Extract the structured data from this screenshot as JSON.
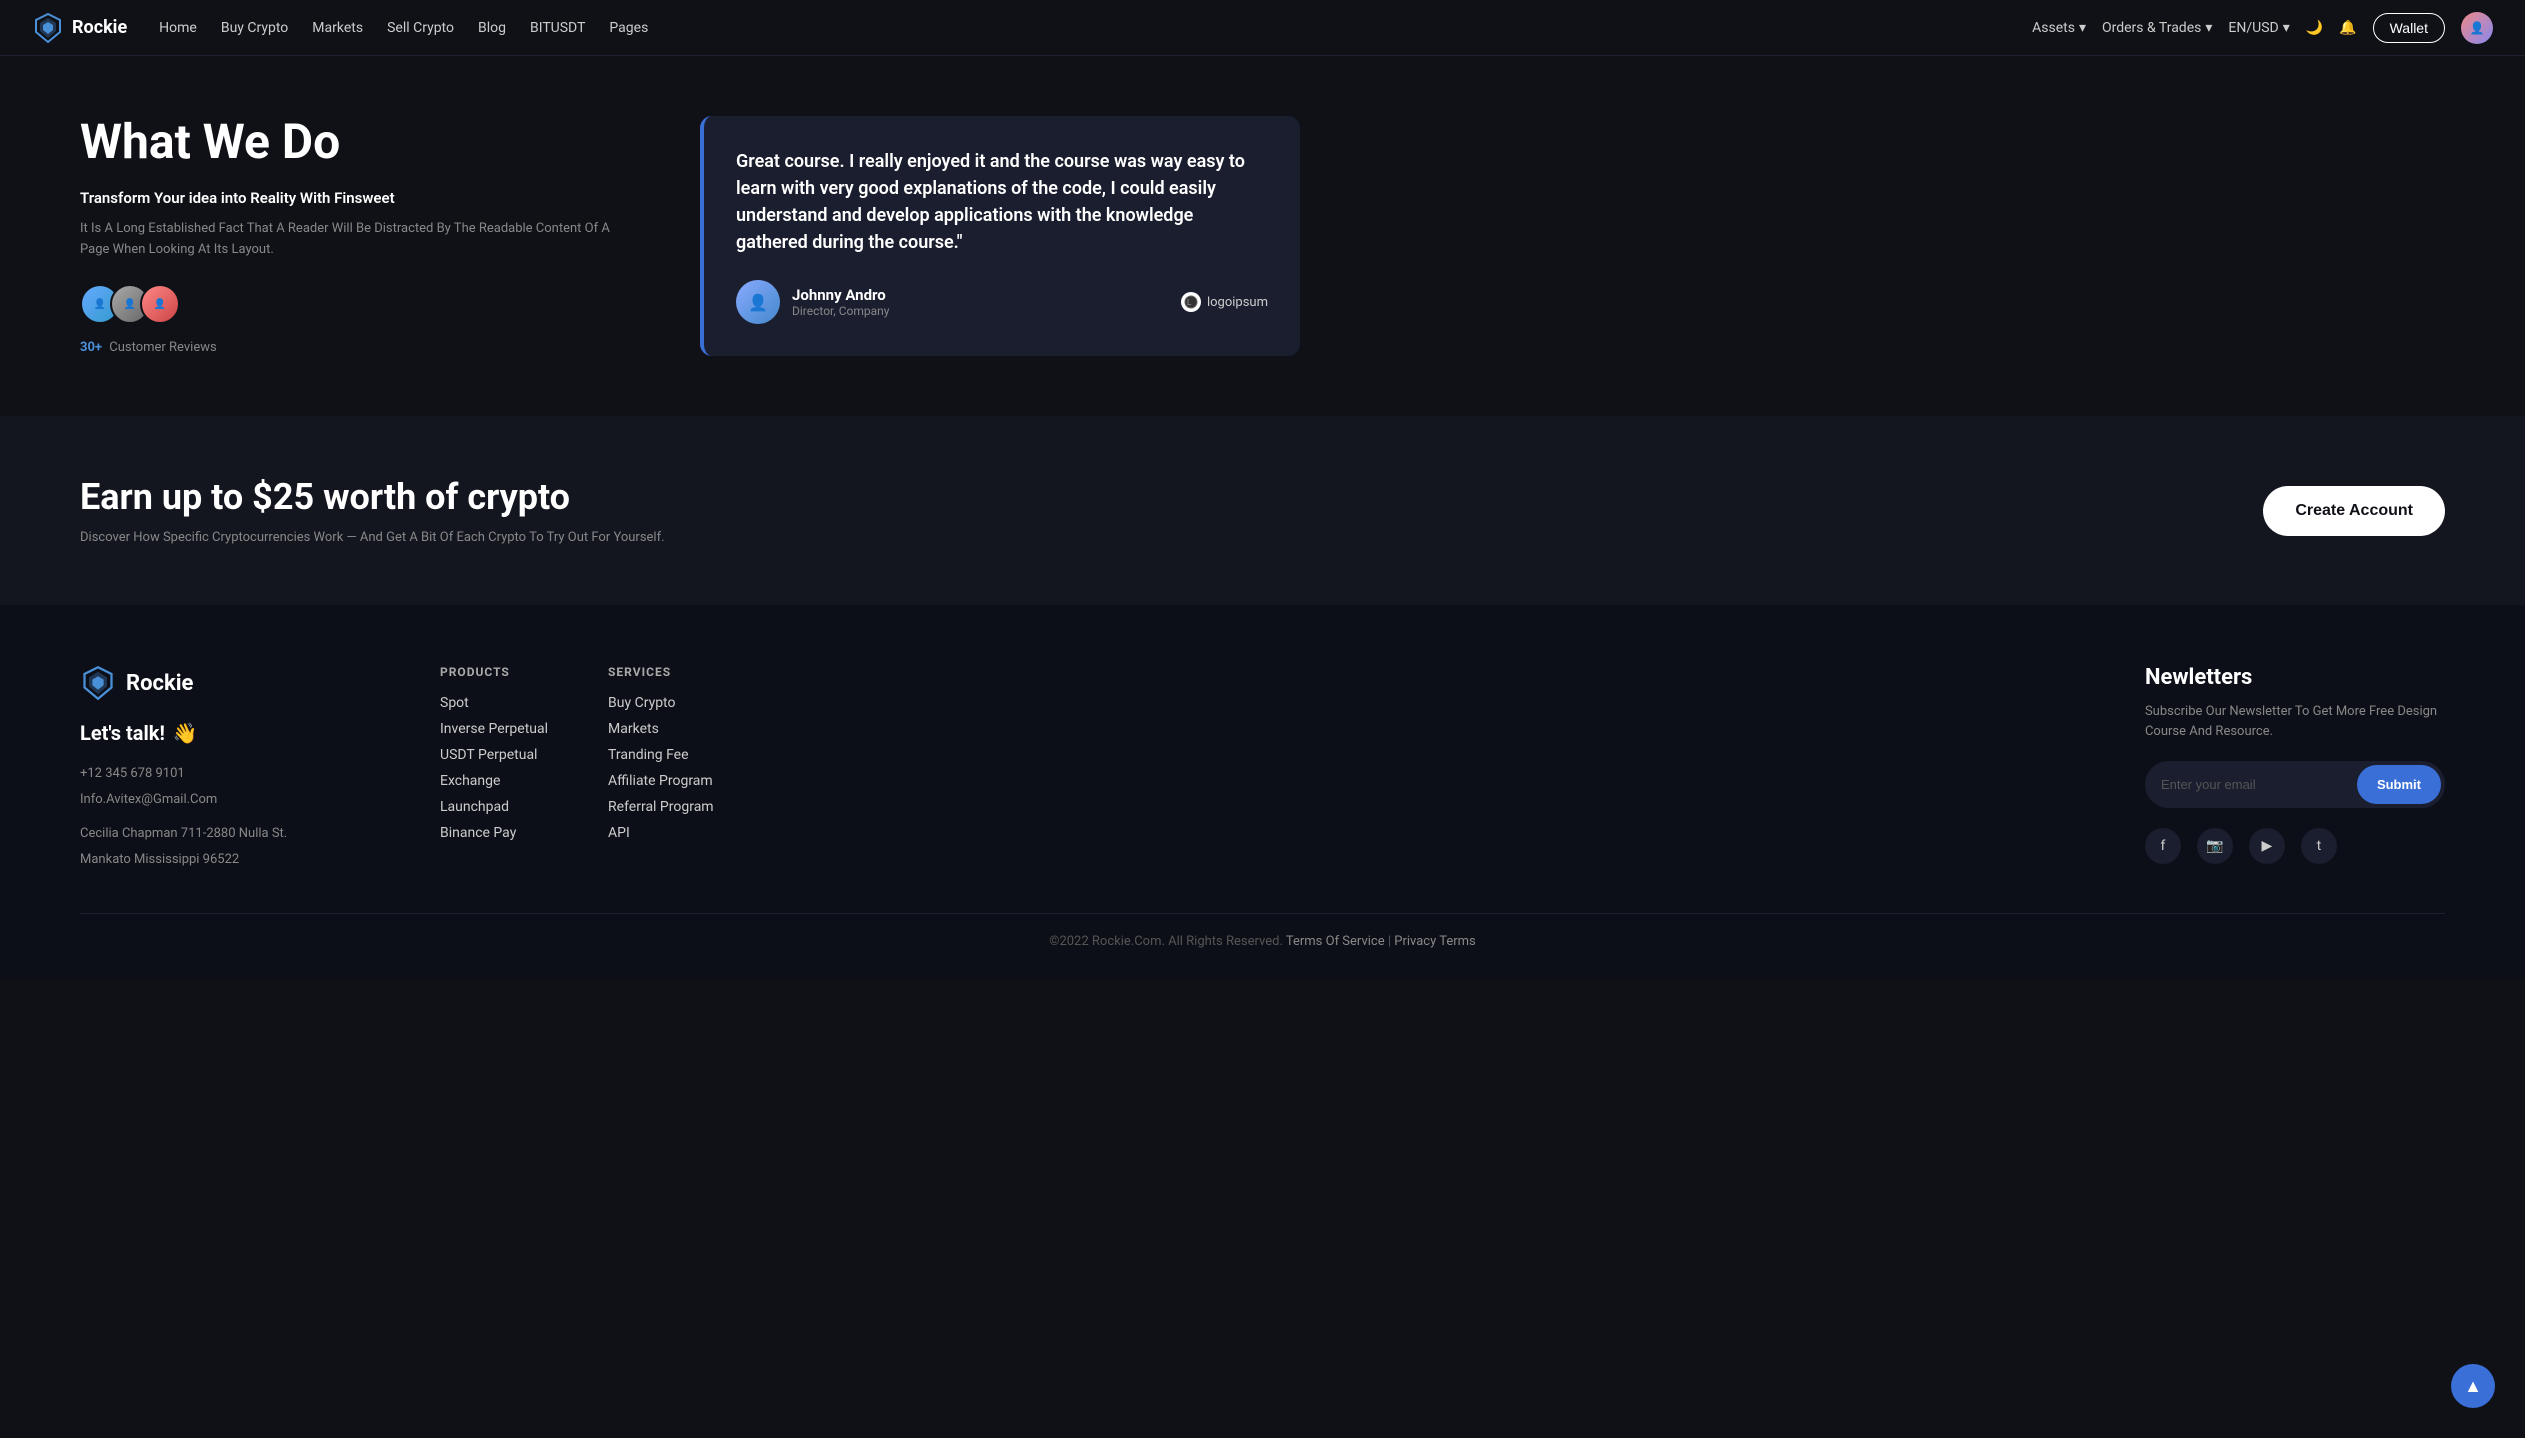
{
  "nav": {
    "brand": "Rockie",
    "links": [
      "Home",
      "Buy Crypto",
      "Markets",
      "Sell Crypto",
      "Blog",
      "BITUSDT",
      "Pages"
    ],
    "right_items": [
      "Assets",
      "Orders & Trades",
      "EN/USD"
    ],
    "wallet_label": "Wallet"
  },
  "what_we_do": {
    "title": "What We Do",
    "subtitle": "Transform Your idea into Reality With Finsweet",
    "description": "It Is A Long Established Fact That A Reader Will Be Distracted By The Readable Content Of A Page When Looking At Its Layout.",
    "reviews_count": "30+",
    "reviews_label": "Customer Reviews"
  },
  "testimonial": {
    "text": "Great course. I really enjoyed it and the course was way easy to learn with very good explanations of the code, I could easily understand and develop applications with the knowledge gathered during the course.\"",
    "author_name": "Johnny Andro",
    "author_role": "Director, Company",
    "logo_text": "logoipsum"
  },
  "earn": {
    "title": "Earn up to $25 worth of crypto",
    "description": "Discover How Specific Cryptocurrencies Work — And Get A Bit Of Each Crypto To Try Out For Yourself.",
    "cta_label": "Create Account"
  },
  "footer": {
    "brand": "Rockie",
    "lets_talk": "Let's talk!",
    "emoji": "👋",
    "phone": "+12 345 678 9101",
    "email": "Info.Avitex@Gmail.Com",
    "address": "Cecilia Chapman 711-2880 Nulla St.\nMankato Mississippi 96522",
    "products_heading": "PRODUCTS",
    "products": [
      "Spot",
      "Inverse Perpetual",
      "USDT Perpetual",
      "Exchange",
      "Launchpad",
      "Binance Pay"
    ],
    "services_heading": "SERVICES",
    "services": [
      "Buy Crypto",
      "Markets",
      "Tranding Fee",
      "Affiliate Program",
      "Referral Program",
      "API"
    ],
    "newsletter_heading": "Newletters",
    "newsletter_desc": "Subscribe Our Newsletter To Get More Free Design Course And Resource.",
    "email_placeholder": "Enter your email",
    "submit_label": "Submit",
    "social_icons": [
      "f",
      "in",
      "▶",
      "t"
    ],
    "copyright": "©2022 Rockie.Com. All Rights Reserved.",
    "terms_label": "Terms Of Service",
    "privacy_label": "Privacy Terms"
  }
}
